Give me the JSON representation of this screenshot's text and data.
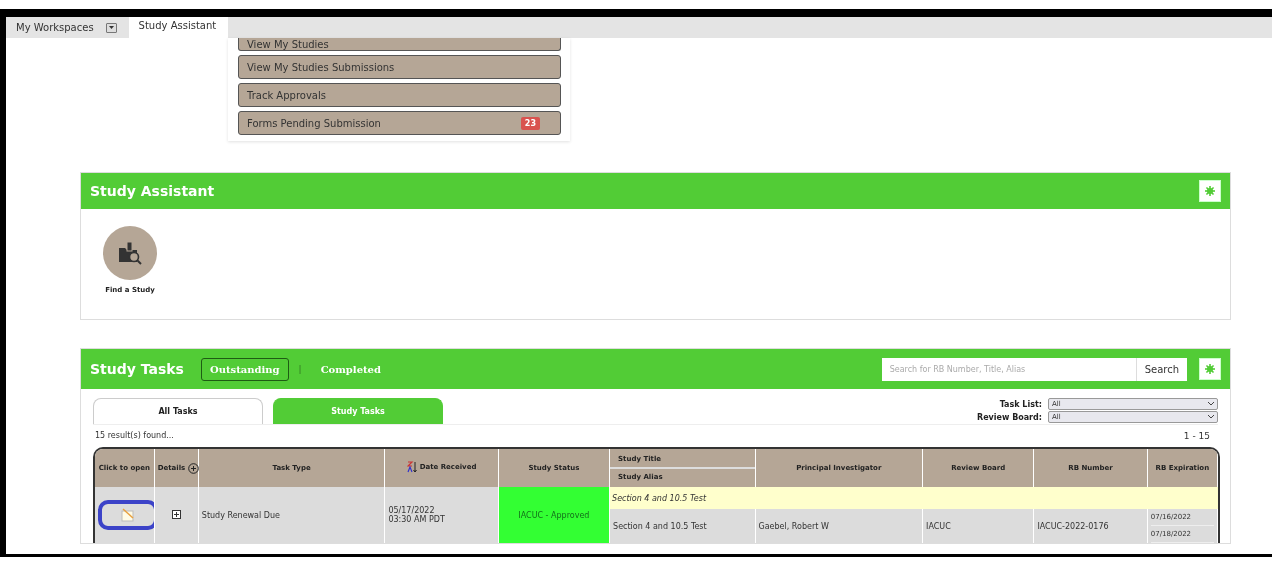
{
  "top_tabs": [
    {
      "label": "My Workspaces",
      "selected": false,
      "dropdown": true
    },
    {
      "label": "Study Assistant",
      "selected": true,
      "dropdown": false
    }
  ],
  "menu": {
    "items": [
      {
        "label": "View My Studies"
      },
      {
        "label": "View My Studies Submissions"
      },
      {
        "label": "Track Approvals"
      },
      {
        "label": "Forms Pending Submission",
        "badge": "23"
      }
    ]
  },
  "study_assistant": {
    "title": "Study Assistant",
    "shortcuts": [
      {
        "label": "Find a Study"
      }
    ]
  },
  "study_tasks": {
    "title": "Study Tasks",
    "filters": [
      {
        "label": "Outstanding",
        "selected": true
      },
      {
        "label": "Completed",
        "selected": false
      }
    ],
    "separator": "|",
    "search": {
      "placeholder": "Search for RB Number, Title, Alias",
      "button": "Search"
    },
    "tabs": [
      {
        "label": "All Tasks",
        "selected": false
      },
      {
        "label": "Study Tasks",
        "selected": true
      }
    ],
    "selects": [
      {
        "label": "Task List:",
        "value": "All"
      },
      {
        "label": "Review Board:",
        "value": "All"
      }
    ],
    "result_count": "15 result(s) found...",
    "range": "1 - 15",
    "table": {
      "columns": [
        {
          "label": "Click to open"
        },
        {
          "label": "Details"
        },
        {
          "label": "Task Type"
        },
        {
          "label": "Date Received",
          "sorted": true
        },
        {
          "label": "Study Status"
        },
        {
          "label": "Study Title",
          "sublabel": "Study Alias"
        },
        {
          "label": "Principal Investigator"
        },
        {
          "label": "Review Board"
        },
        {
          "label": "RB Number"
        },
        {
          "label": "RB Expiration"
        }
      ],
      "rows": [
        {
          "title": "Section 4 and 10.5 Test",
          "task_type": "Study Renewal Due",
          "date_received": [
            "05/17/2022",
            "03:30 AM PDT"
          ],
          "study_status": "IACUC - Approved",
          "alias": "Section 4 and 10.5 Test",
          "pi": "Gaebel, Robert W",
          "review_board": "IACUC",
          "rb_number": "IACUC-2022-0176",
          "rb_expiration": [
            "07/16/2022",
            "07/18/2022"
          ],
          "highlighted": true
        }
      ]
    }
  }
}
